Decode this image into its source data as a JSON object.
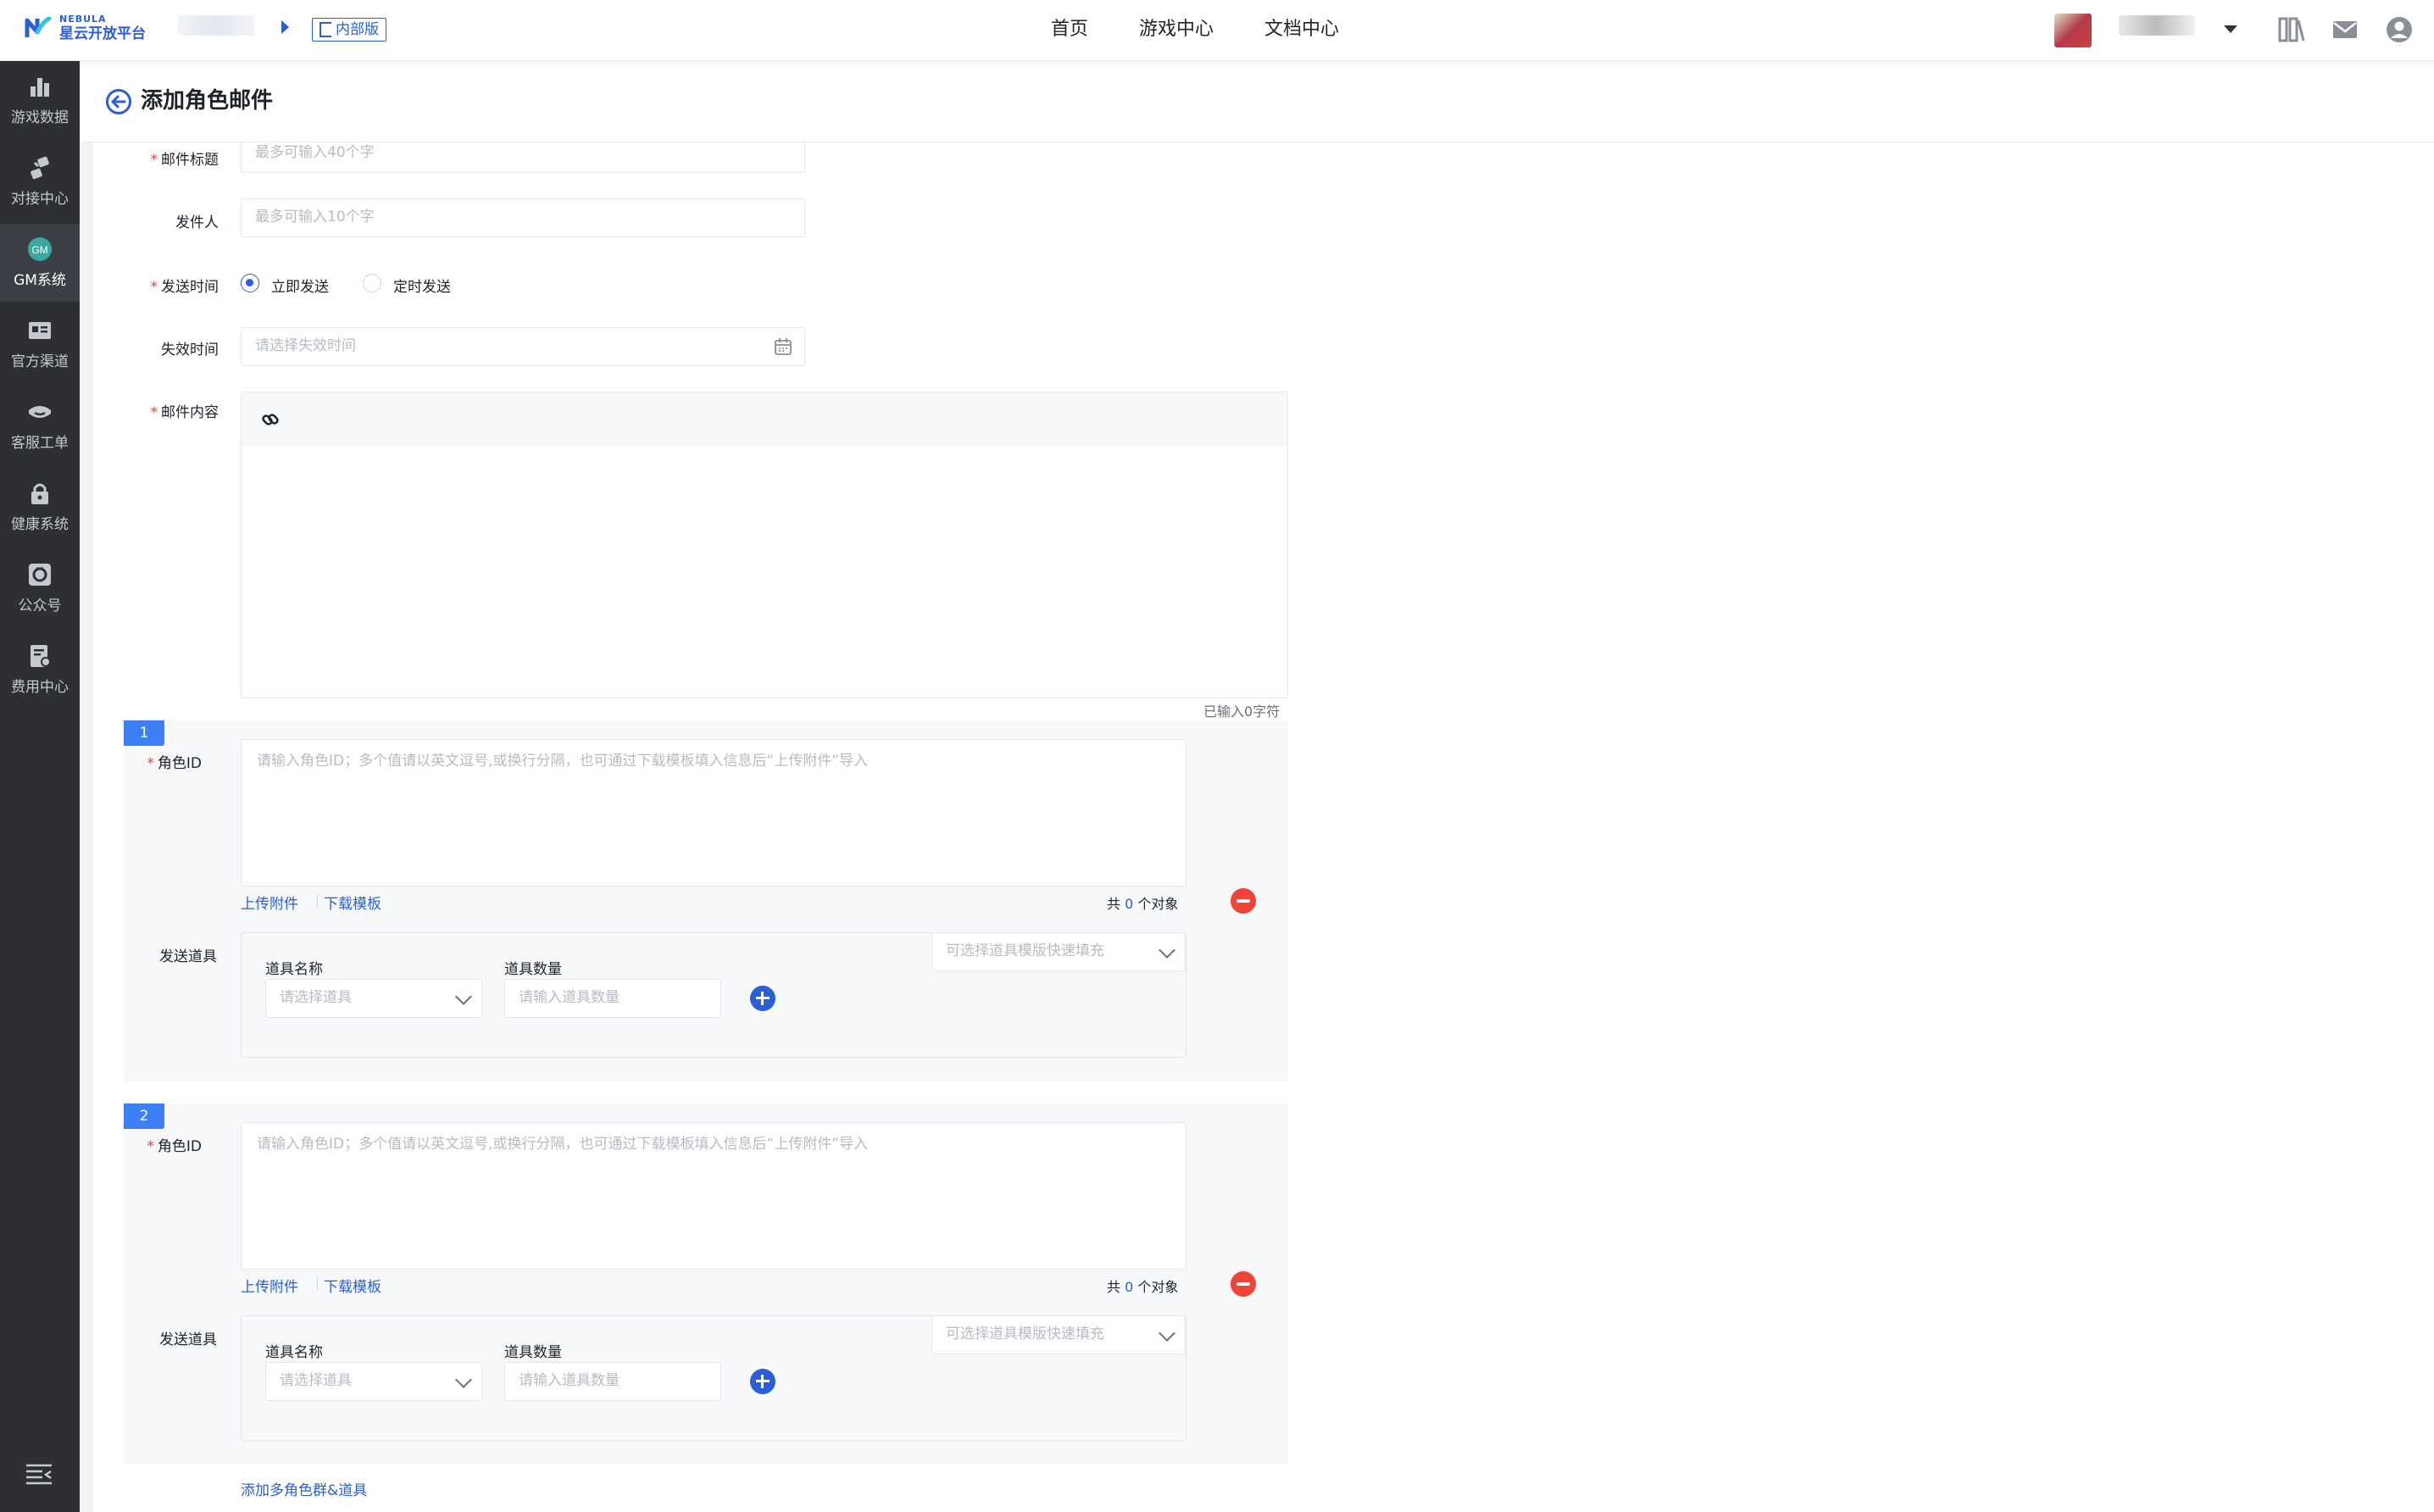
{
  "header": {
    "logo_en": "NEBULA",
    "logo_cn": "星云开放平台",
    "tag": "内部版",
    "nav": [
      "首页",
      "游戏中心",
      "文档中心"
    ],
    "accent": "#2b5fd9"
  },
  "sidebar": {
    "items": [
      {
        "label": "游戏数据",
        "icon": "bar-chart-icon"
      },
      {
        "label": "对接中心",
        "icon": "link-blocks-icon"
      },
      {
        "label": "GM系统",
        "icon": "gm-badge-icon",
        "icon_text": "GM"
      },
      {
        "label": "官方渠道",
        "icon": "id-card-icon"
      },
      {
        "label": "客服工单",
        "icon": "headset-icon"
      },
      {
        "label": "健康系统",
        "icon": "lock-icon"
      },
      {
        "label": "公众号",
        "icon": "official-account-icon"
      },
      {
        "label": "费用中心",
        "icon": "bill-icon"
      }
    ],
    "active": "GM系统"
  },
  "page": {
    "title": "添加角色邮件"
  },
  "form": {
    "subject": {
      "label": "邮件标题",
      "placeholder": "最多可输入40个字",
      "required": true
    },
    "sender": {
      "label": "发件人",
      "placeholder": "最多可输入10个字"
    },
    "send_time": {
      "label": "发送时间",
      "options": [
        "立即发送",
        "定时发送"
      ],
      "selected": "立即发送",
      "required": true
    },
    "expire": {
      "label": "失效时间",
      "placeholder": "请选择失效时间"
    },
    "content": {
      "label": "邮件内容",
      "required": true,
      "counter": "已输入0字符"
    }
  },
  "groups": [
    {
      "index": "1",
      "role_label": "角色ID",
      "role_placeholder": "请输入角色ID；多个值请以英文逗号,或换行分隔，也可通过下载模板填入信息后“上传附件”导入",
      "upload": "上传附件",
      "download": "下载模板",
      "count_prefix": "共",
      "count": "0",
      "count_suffix": "个对象",
      "props_label": "发送道具",
      "template_placeholder": "可选择道具模版快速填充",
      "item_name_label": "道具名称",
      "item_name_placeholder": "请选择道具",
      "item_qty_label": "道具数量",
      "item_qty_placeholder": "请输入道具数量"
    },
    {
      "index": "2",
      "role_label": "角色ID",
      "role_placeholder": "请输入角色ID；多个值请以英文逗号,或换行分隔，也可通过下载模板填入信息后“上传附件”导入",
      "upload": "上传附件",
      "download": "下载模板",
      "count_prefix": "共",
      "count": "0",
      "count_suffix": "个对象",
      "props_label": "发送道具",
      "template_placeholder": "可选择道具模版快速填充",
      "item_name_label": "道具名称",
      "item_name_placeholder": "请选择道具",
      "item_qty_label": "道具数量",
      "item_qty_placeholder": "请输入道具数量"
    }
  ],
  "add_group": "添加多角色群&道具"
}
